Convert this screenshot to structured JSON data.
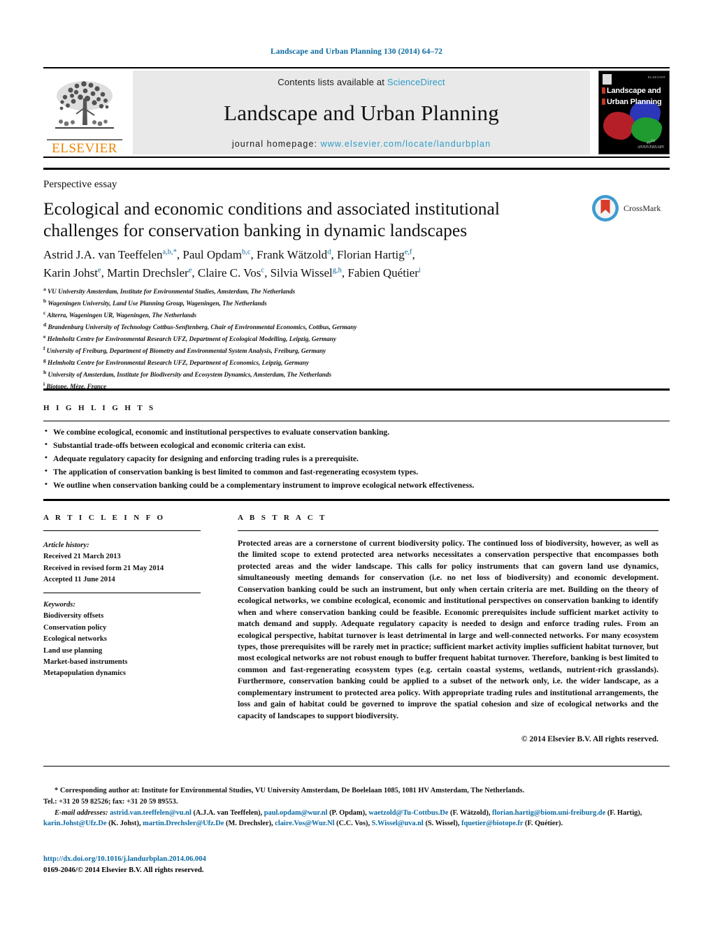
{
  "running_head": "Landscape and Urban Planning 130 (2014) 64–72",
  "masthead": {
    "contents_prefix": "Contents lists available at ",
    "contents_link": "ScienceDirect",
    "journal_title": "Landscape and Urban Planning",
    "homepage_prefix": "journal homepage: ",
    "homepage_url": "www.elsevier.com/locate/landurbplan",
    "publisher_name": "ELSEVIER",
    "cover": {
      "line1": "Landscape and",
      "line2": "Urban Planning",
      "top_text": "“ELSEVIER”",
      "anniversary": "40ᵀᴴ\nANNIVERSARY"
    }
  },
  "article": {
    "type": "Perspective essay",
    "title": "Ecological and economic conditions and associated institutional challenges for conservation banking in dynamic landscapes",
    "authors_line1": "Astrid J.A. van Teeffelen",
    "authors": [
      {
        "name": "Astrid J.A. van Teeffelen",
        "sup": "a,b,*"
      },
      {
        "name": "Paul Opdam",
        "sup": "b,c"
      },
      {
        "name": "Frank Wätzold",
        "sup": "d"
      },
      {
        "name": "Florian Hartig",
        "sup": "e,f"
      },
      {
        "name": "Karin Johst",
        "sup": "e"
      },
      {
        "name": "Martin Drechsler",
        "sup": "e"
      },
      {
        "name": "Claire C. Vos",
        "sup": "c"
      },
      {
        "name": "Silvia Wissel",
        "sup": "g,h"
      },
      {
        "name": "Fabien Quétier",
        "sup": "i"
      }
    ],
    "affiliations": [
      {
        "marker": "a",
        "text": "VU University Amsterdam, Institute for Environmental Studies, Amsterdam, The Netherlands"
      },
      {
        "marker": "b",
        "text": "Wageningen University, Land Use Planning Group, Wageningen, The Netherlands"
      },
      {
        "marker": "c",
        "text": "Alterra, Wageningen UR, Wageningen, The Netherlands"
      },
      {
        "marker": "d",
        "text": "Brandenburg University of Technology Cottbus-Senftenberg, Chair of Environmental Economics, Cottbus, Germany"
      },
      {
        "marker": "e",
        "text": "Helmholtz Centre for Environmental Research UFZ, Department of Ecological Modelling, Leipzig, Germany"
      },
      {
        "marker": "f",
        "text": "University of Freiburg, Department of Biometry and Environmental System Analysis, Freiburg, Germany"
      },
      {
        "marker": "g",
        "text": "Helmholtz Centre for Environmental Research UFZ, Department of Economics, Leipzig, Germany"
      },
      {
        "marker": "h",
        "text": "University of Amsterdam, Institute for Biodiversity and Ecosystem Dynamics, Amsterdam, The Netherlands"
      },
      {
        "marker": "i",
        "text": "Biotope, Mèze, France"
      }
    ]
  },
  "crossmark": {
    "label": "CrossMark"
  },
  "highlights": {
    "label": "H I G H L I G H T S",
    "items": [
      "We combine ecological, economic and institutional perspectives to evaluate conservation banking.",
      "Substantial trade-offs between ecological and economic criteria can exist.",
      "Adequate regulatory capacity for designing and enforcing trading rules is a prerequisite.",
      "The application of conservation banking is best limited to common and fast-regenerating ecosystem types.",
      "We outline when conservation banking could be a complementary instrument to improve ecological network effectiveness."
    ]
  },
  "article_info": {
    "label": "A R T I C L E    I N F O",
    "history_header": "Article history:",
    "history": [
      "Received 21 March 2013",
      "Received in revised form 21 May 2014",
      "Accepted 11 June 2014"
    ],
    "keywords_header": "Keywords:",
    "keywords": [
      "Biodiversity offsets",
      "Conservation policy",
      "Ecological networks",
      "Land use planning",
      "Market-based instruments",
      "Metapopulation dynamics"
    ]
  },
  "abstract": {
    "label": "A B S T R A C T",
    "text": "Protected areas are a cornerstone of current biodiversity policy. The continued loss of biodiversity, however, as well as the limited scope to extend protected area networks necessitates a conservation perspective that encompasses both protected areas and the wider landscape. This calls for policy instruments that can govern land use dynamics, simultaneously meeting demands for conservation (i.e. no net loss of biodiversity) and economic development. Conservation banking could be such an instrument, but only when certain criteria are met. Building on the theory of ecological networks, we combine ecological, economic and institutional perspectives on conservation banking to identify when and where conservation banking could be feasible. Economic prerequisites include sufficient market activity to match demand and supply. Adequate regulatory capacity is needed to design and enforce trading rules. From an ecological perspective, habitat turnover is least detrimental in large and well-connected networks. For many ecosystem types, those prerequisites will be rarely met in practice; sufficient market activity implies sufficient habitat turnover, but most ecological networks are not robust enough to buffer frequent habitat turnover. Therefore, banking is best limited to common and fast-regenerating ecosystem types (e.g. certain coastal systems, wetlands, nutrient-rich grasslands). Furthermore, conservation banking could be applied to a subset of the network only, i.e. the wider landscape, as a complementary instrument to protected area policy. With appropriate trading rules and institutional arrangements, the loss and gain of habitat could be governed to improve the spatial cohesion and size of ecological networks and the capacity of landscapes to support biodiversity.",
    "copyright": "© 2014 Elsevier B.V. All rights reserved."
  },
  "footnotes": {
    "corresponding_star": "*",
    "corresponding": "Corresponding author at: Institute for Environmental Studies, VU University Amsterdam, De Boelelaan 1085, 1081 HV Amsterdam, The Netherlands.",
    "tel_fax": "Tel.: +31 20 59 82526; fax: +31 20 59 89553.",
    "email_label": "E-mail addresses:",
    "emails": [
      {
        "address": "astrid.van.teeffelen@vu.nl",
        "person": "(A.J.A. van Teeffelen),"
      },
      {
        "address": "paul.opdam@wur.nl",
        "person": "(P. Opdam),"
      },
      {
        "address": "waetzold@Tu-Cottbus.De",
        "person": "(F. Wätzold),"
      },
      {
        "address": "florian.hartig@biom.uni-freiburg.de",
        "person": "(F. Hartig),"
      },
      {
        "address": "karin.Johst@Ufz.De",
        "person": "(K. Johst),"
      },
      {
        "address": "martin.Drechsler@Ufz.De",
        "person": "(M. Drechsler),"
      },
      {
        "address": "claire.Vos@Wur.Nl",
        "person": "(C.C. Vos),"
      },
      {
        "address": "S.Wissel@uva.nl",
        "person": "(S. Wissel),"
      },
      {
        "address": "fquetier@biotope.fr",
        "person": "(F. Quétier)."
      }
    ]
  },
  "doi_block": {
    "doi": "http://dx.doi.org/10.1016/j.landurbplan.2014.06.004",
    "issn_line": "0169-2046/© 2014 Elsevier B.V. All rights reserved."
  }
}
